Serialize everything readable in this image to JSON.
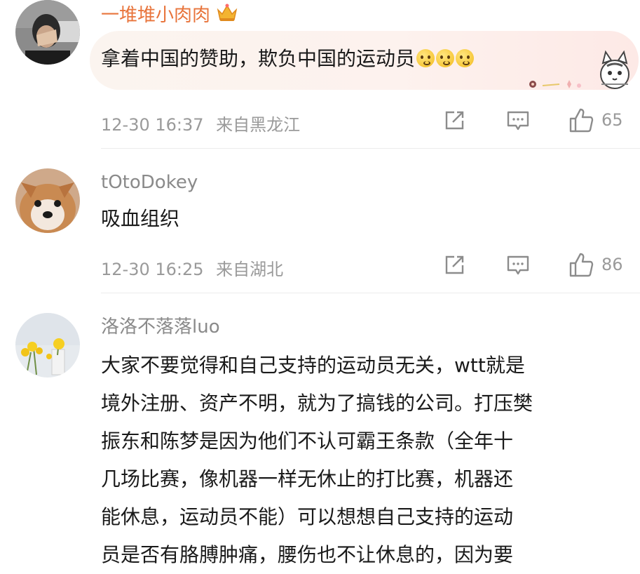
{
  "comments": [
    {
      "username": "一堆堆小肉肉",
      "text": "拿着中国的赞助，欺负中国的运动员",
      "timestamp": "12-30 16:37",
      "location": "来自黑龙江",
      "likes": "65",
      "badge_icon": "crown-icon",
      "text_emojis": [
        "thinking-emoji",
        "thinking-emoji",
        "thinking-emoji"
      ]
    },
    {
      "username": "tOtoDokey",
      "text": "吸血组织",
      "timestamp": "12-30 16:25",
      "location": "来自湖北",
      "likes": "86"
    },
    {
      "username": "洛洛不落落luo",
      "lines": [
        "大家不要觉得和自己支持的运动员无关，wtt就是",
        "境外注册、资产不明，就为了搞钱的公司。打压樊",
        "振东和陈梦是因为他们不认可霸王条款（全年十",
        "几场比赛，像机器一样无休止的打比赛，机器还",
        "能休息，运动员不能）可以想想自己支持的运动",
        "员是否有胳膊肿痛，腰伤也不让休息的，因为要"
      ]
    }
  ],
  "colors": {
    "vip_name": "#e8743b",
    "name": "#8a8a8a",
    "meta": "#9a9a9a",
    "text": "#1a1a1a"
  }
}
